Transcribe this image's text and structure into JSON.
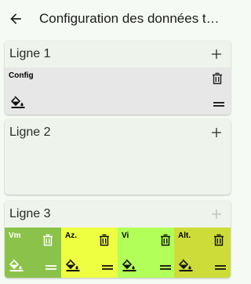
{
  "appbar": {
    "title": "Configuration des données te…",
    "back_icon": "arrow-left-icon"
  },
  "rows": [
    {
      "label": "Ligne 1",
      "add_enabled": true,
      "tiles": [
        {
          "name": "Config",
          "color": "#e7e7e7"
        }
      ]
    },
    {
      "label": "Ligne 2",
      "add_enabled": true,
      "tiles": []
    },
    {
      "label": "Ligne 3",
      "add_enabled": false,
      "tiles": [
        {
          "name": "Vm",
          "color": "#8bc34a",
          "text_color": "#ffffff"
        },
        {
          "name": "Az.",
          "color": "#eeff41",
          "text_color": "#000000"
        },
        {
          "name": "Vi",
          "color": "#b2ff59",
          "text_color": "#000000"
        },
        {
          "name": "Alt.",
          "color": "#cddc39",
          "text_color": "#000000"
        }
      ]
    }
  ],
  "icons": {
    "add": "plus-icon",
    "delete": "trash-icon",
    "color": "paint-bucket-icon",
    "drag": "drag-handle-icon"
  },
  "colors": {
    "background": "#f6faf4",
    "card": "#eef3ec",
    "add_disabled": "#b9bcb8"
  }
}
